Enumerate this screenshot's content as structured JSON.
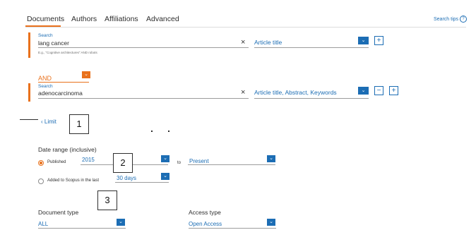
{
  "tabs": [
    {
      "label": "Documents",
      "active": true
    },
    {
      "label": "Authors",
      "active": false
    },
    {
      "label": "Affiliations",
      "active": false
    },
    {
      "label": "Advanced",
      "active": false
    }
  ],
  "search_tips": {
    "label": "Search tips",
    "icon": "help-circle-icon",
    "glyph": "?"
  },
  "search1": {
    "label": "Search",
    "value": "lang cancer",
    "hint": "E.g., \"Cognitive architectures\" AND robots",
    "clear_glyph": "×",
    "field": "Article title",
    "add_glyph": "+"
  },
  "operator": {
    "value": "AND"
  },
  "search2": {
    "label": "Search",
    "value": "adenocarcinoma",
    "clear_glyph": "×",
    "field": "Article title, Abstract, Keywords",
    "remove_glyph": "−",
    "add_glyph": "+"
  },
  "limit": {
    "label": "Limit",
    "chevron": "‹"
  },
  "callouts": [
    "1",
    "2",
    "3"
  ],
  "date_range": {
    "heading": "Date range (inclusive)",
    "published_label": "Published",
    "published_from": "2015",
    "to_label": "to",
    "published_to": "Present",
    "added_label": "Added to Scopus in the last",
    "added_value": "30 days",
    "selected": "published"
  },
  "document_type": {
    "heading": "Document type",
    "value": "ALL"
  },
  "access_type": {
    "heading": "Access type",
    "value": "Open Access"
  },
  "dropdown_glyph": "⌄",
  "colors": {
    "accent": "#e9711c",
    "link": "#1c6db4",
    "text": "#2e2e2e"
  }
}
